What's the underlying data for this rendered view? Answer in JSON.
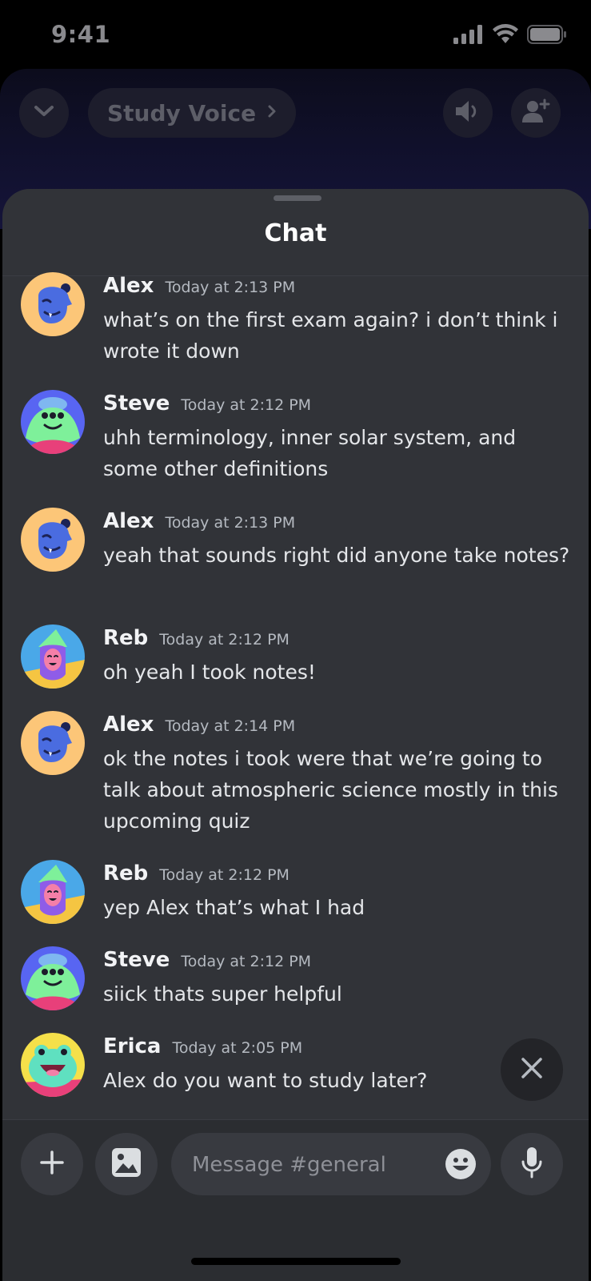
{
  "status_bar": {
    "time": "9:41"
  },
  "voice_header": {
    "channel_name": "Study Voice"
  },
  "sheet": {
    "title": "Chat"
  },
  "messages": [
    {
      "author": "Alex",
      "timestamp": "Today at 2:13 PM",
      "text": "what’s on the first exam again? i don’t think i wrote it down",
      "avatar": "alex"
    },
    {
      "author": "Steve",
      "timestamp": "Today at 2:12 PM",
      "text": "uhh terminology, inner solar system, and some other definitions",
      "avatar": "steve"
    },
    {
      "author": "Alex",
      "timestamp": "Today at 2:13 PM",
      "text": "yeah that sounds right did anyone take notes?",
      "avatar": "alex"
    },
    {
      "author": "Reb",
      "timestamp": "Today at 2:12 PM",
      "text": "oh yeah I took notes!",
      "avatar": "reb"
    },
    {
      "author": "Alex",
      "timestamp": "Today at 2:14 PM",
      "text": "ok the notes i took were that we’re going to talk about atmospheric science mostly in this upcoming quiz",
      "avatar": "alex"
    },
    {
      "author": "Reb",
      "timestamp": "Today at 2:12 PM",
      "text": "yep Alex that’s what I had",
      "avatar": "reb"
    },
    {
      "author": "Steve",
      "timestamp": "Today at 2:12 PM",
      "text": "siick thats super helpful",
      "avatar": "steve"
    },
    {
      "author": "Erica",
      "timestamp": "Today at 2:05 PM",
      "text": "Alex do you want to study later?",
      "avatar": "erica"
    }
  ],
  "composer": {
    "placeholder": "Message #general"
  },
  "icons": {
    "collapse": "chevron-down-icon",
    "speaker": "speaker-icon",
    "add_user": "add-user-icon",
    "close": "close-icon",
    "plus": "plus-icon",
    "image": "image-icon",
    "emoji": "emoji-icon",
    "mic": "microphone-icon"
  }
}
